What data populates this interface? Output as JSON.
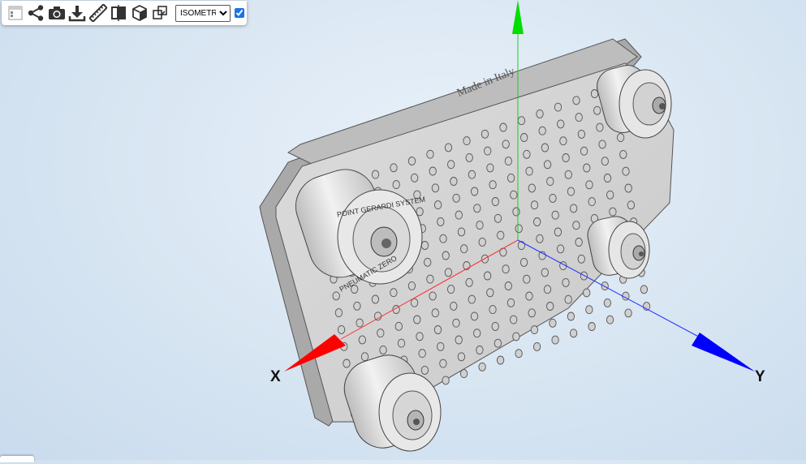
{
  "toolbar": {
    "items": [
      {
        "name": "layers-icon"
      },
      {
        "name": "share-icon"
      },
      {
        "name": "camera-icon"
      },
      {
        "name": "download-icon"
      },
      {
        "name": "ruler-icon"
      },
      {
        "name": "section-plane-icon"
      },
      {
        "name": "cube-icon"
      },
      {
        "name": "explode-icon"
      }
    ],
    "view_select": {
      "selected": "ISOMETRIC",
      "options": [
        "ISOMETRIC"
      ]
    },
    "checkbox_checked": true
  },
  "axes": {
    "x_label": "X",
    "y_label": "Y",
    "colors": {
      "x": "#ff0000",
      "y": "#0000ff",
      "z": "#00cc00"
    }
  },
  "model": {
    "plate_engraving": "Made in Italy",
    "chuck_engraving": "POINT GERARDI SYSTEM",
    "chuck_engraving_2": "PNEUMATIC ZERO"
  }
}
